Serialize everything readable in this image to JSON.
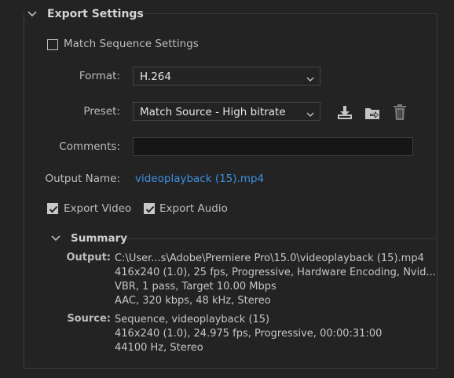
{
  "section": {
    "title": "Export Settings"
  },
  "match_sequence": {
    "label": "Match Sequence Settings",
    "checked": false
  },
  "format": {
    "label": "Format:",
    "value": "H.264"
  },
  "preset": {
    "label": "Preset:",
    "value": "Match Source - High bitrate"
  },
  "comments": {
    "label": "Comments:",
    "value": ""
  },
  "output_name": {
    "label": "Output Name:",
    "value": "videoplayback (15).mp4"
  },
  "export_video": {
    "label": "Export Video",
    "checked": true
  },
  "export_audio": {
    "label": "Export Audio",
    "checked": true
  },
  "summary": {
    "title": "Summary",
    "output_label": "Output:",
    "output_lines": [
      "C:\\User...s\\Adobe\\Premiere Pro\\15.0\\videoplayback (15).mp4",
      "416x240 (1.0), 25 fps, Progressive, Hardware Encoding, Nvid...",
      "VBR, 1 pass, Target 10.00 Mbps",
      "AAC, 320 kbps, 48 kHz, Stereo"
    ],
    "source_label": "Source:",
    "source_lines": [
      "Sequence, videoplayback (15)",
      "416x240 (1.0), 24.975 fps, Progressive, 00:00:31:00",
      "44100 Hz, Stereo"
    ]
  },
  "icons": {
    "import_preset": "download-tray-icon",
    "manage_presets": "folder-arrow-icon",
    "delete_preset": "trash-icon"
  },
  "colors": {
    "background": "#232323",
    "link": "#3f8fe0",
    "border": "#3a3a3a"
  }
}
